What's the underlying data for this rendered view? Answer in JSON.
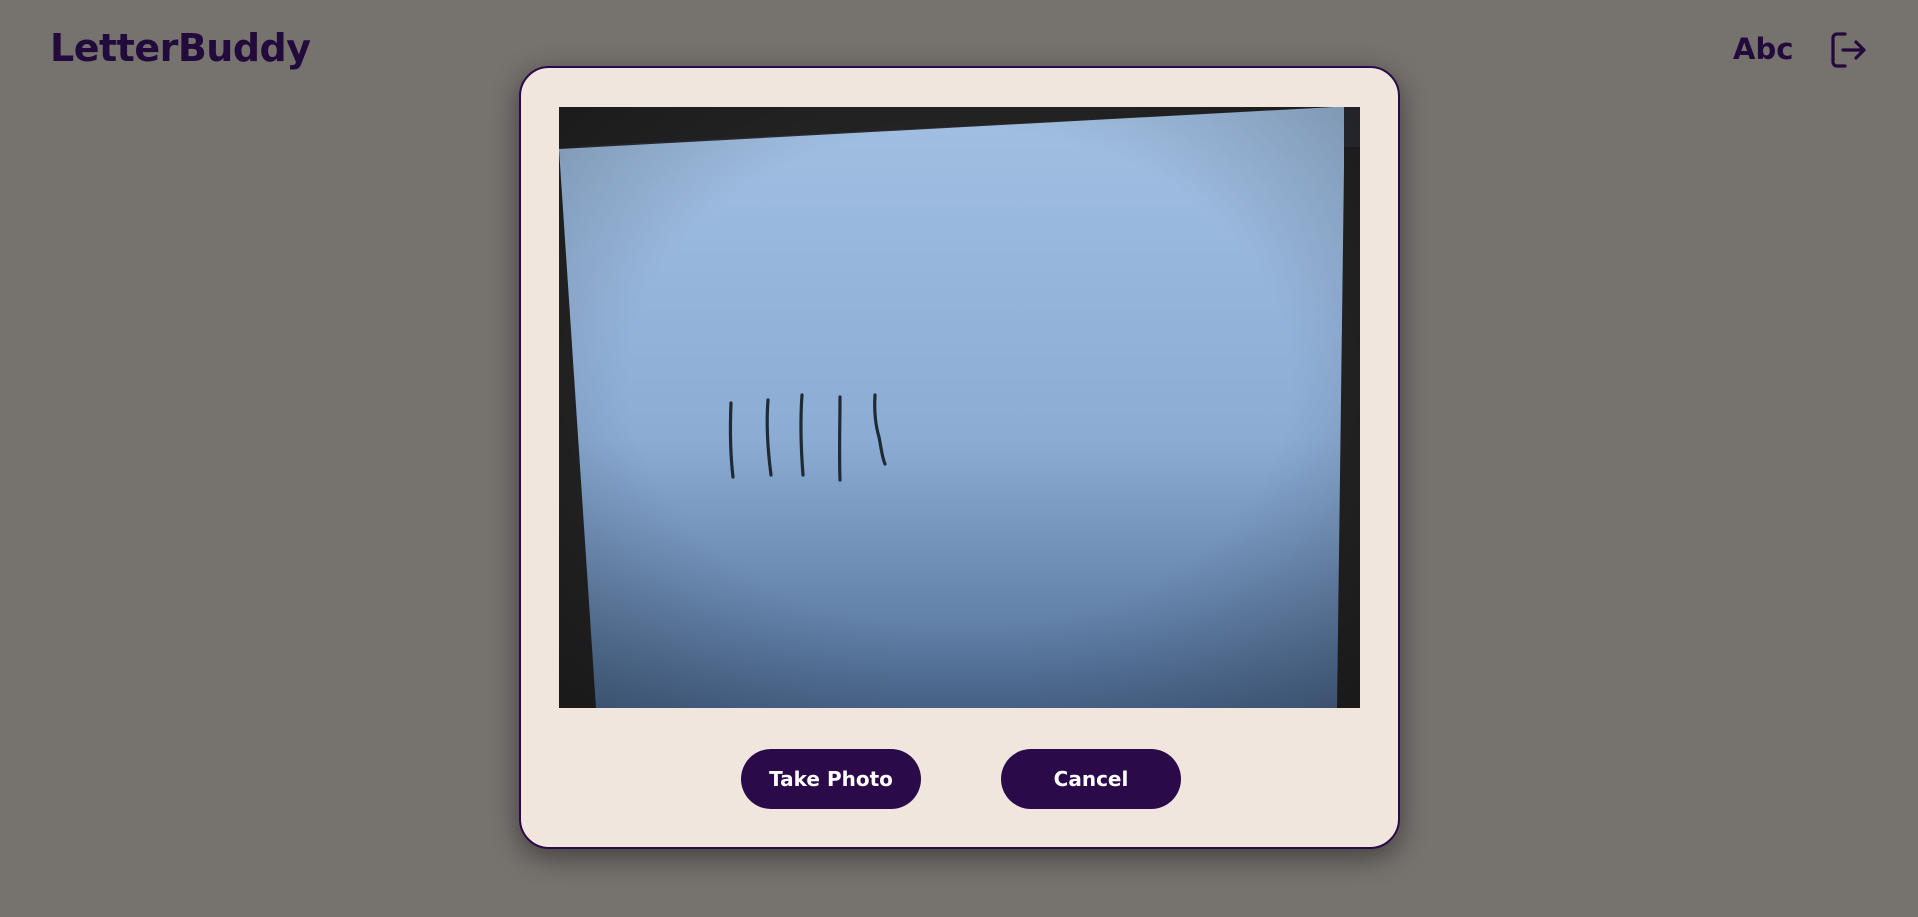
{
  "header": {
    "brand": "LetterBuddy",
    "abc_icon_text": "Abc",
    "logout_icon": "logout-icon"
  },
  "modal": {
    "preview_icon": "camera-feed",
    "take_photo_label": "Take Photo",
    "cancel_label": "Cancel"
  },
  "colors": {
    "backdrop": "#76726e",
    "modal_bg": "#f0e6dd",
    "accent": "#2b0a4a",
    "brand_text": "#220a3d",
    "button_text": "#ffffff"
  }
}
